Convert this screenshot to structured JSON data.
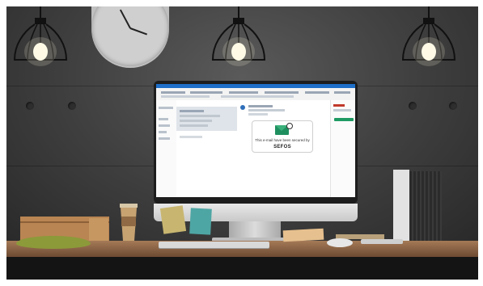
{
  "scene": "Office desk with a desktop monitor showing an email client",
  "email_notice": {
    "secured_text": "This e-mail have been secured by",
    "brand": "SEFOS"
  },
  "icons": {
    "envelope": "envelope-icon",
    "lock": "lock-icon"
  },
  "colors": {
    "brand_green": "#1f9a63",
    "ribbon_blue": "#1e6fc8",
    "wall": "#3e3e3e",
    "desk": "#8a5f42"
  }
}
